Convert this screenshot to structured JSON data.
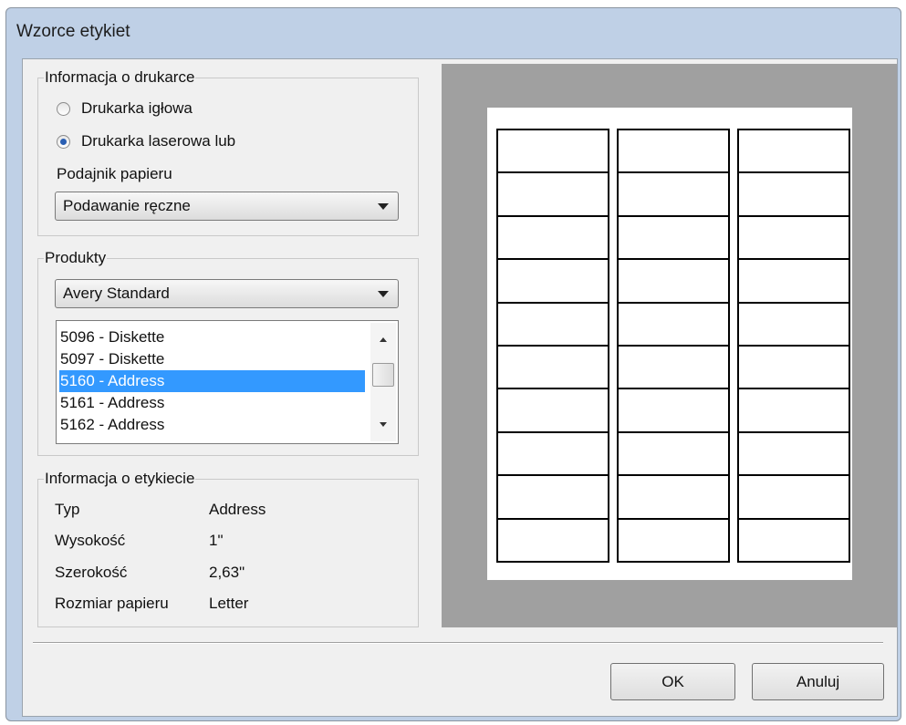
{
  "window": {
    "title": "Wzorce etykiet"
  },
  "printer_info": {
    "legend": "Informacja o drukarce",
    "radio_dot_matrix": "Drukarka igłowa",
    "radio_laser": "Drukarka laserowa lub",
    "selected_printer": "Drukarka laserowa lub",
    "tray_label": "Podajnik papieru",
    "tray_value": "Podawanie ręczne"
  },
  "products": {
    "legend": "Produkty",
    "vendor_value": "Avery Standard",
    "list_items": [
      "5096 - Diskette",
      "5097 - Diskette",
      "5160 - Address",
      "5161 - Address",
      "5162 - Address"
    ],
    "selected_item": "5160 - Address"
  },
  "label_info": {
    "legend": "Informacja o etykiecie",
    "rows": [
      {
        "key": "Typ",
        "value": "Address"
      },
      {
        "key": "Wysokość",
        "value": "1\""
      },
      {
        "key": "Szerokość",
        "value": "2,63\""
      },
      {
        "key": "Rozmiar papieru",
        "value": "Letter"
      }
    ]
  },
  "preview": {
    "columns": 3,
    "rows": 10
  },
  "buttons": {
    "ok": "OK",
    "cancel": "Anuluj"
  },
  "colors": {
    "selection": "#3399ff",
    "preview_bg": "#a0a0a0",
    "window_frame": "#bfd0e6"
  }
}
